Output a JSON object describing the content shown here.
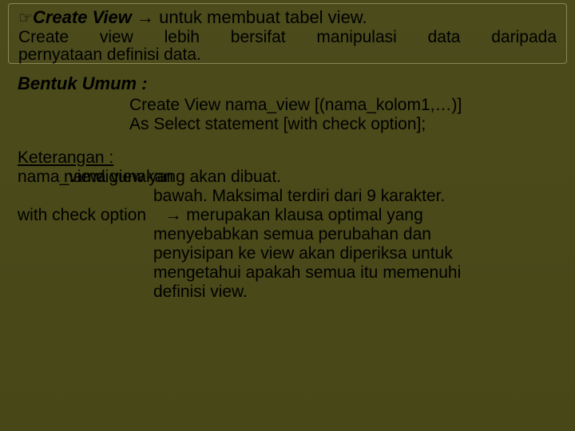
{
  "title": {
    "icon": "☞",
    "name": "Create View",
    "arrow": "→",
    "purpose": "untuk membuat tabel view."
  },
  "intro": {
    "line1": "Create view lebih bersifat manipulasi data daripada",
    "line2": "pernyataan definisi data."
  },
  "section_heading": "Bentuk Umum :",
  "code": {
    "l1": "Create View nama_view [(nama_kolom1,…)]",
    "l2": "As Select statement [with check option];"
  },
  "keterangan_heading": "Keterangan  :",
  "overlap": {
    "a": "nama_view",
    "b": "nama view yang akan dibuat.",
    "c": "digunakan"
  },
  "desc_line2": "bawah. Maksimal terdiri dari 9 karakter.",
  "wco": {
    "label": "with check option",
    "arrow": "→",
    "first": "merupakan klausa optimal yang",
    "rest1": "menyebabkan semua perubahan dan",
    "rest2": "penyisipan ke view akan diperiksa untuk",
    "rest3": "mengetahui apakah semua itu memenuhi",
    "rest4": "definisi view."
  }
}
